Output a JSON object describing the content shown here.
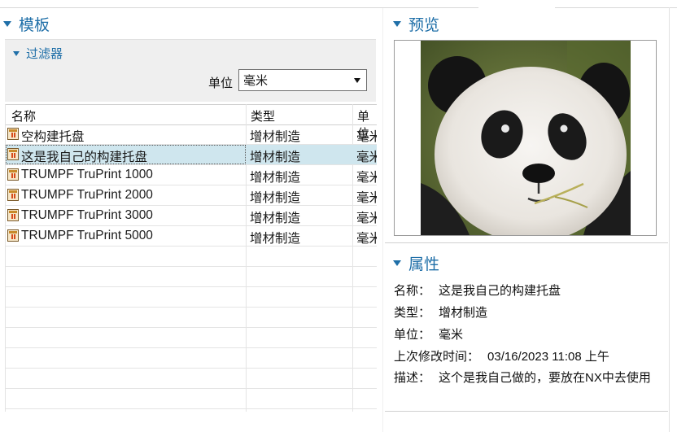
{
  "templates": {
    "title": "模板",
    "filter": {
      "title": "过滤器",
      "unit_label": "单位",
      "unit_value": "毫米"
    },
    "columns": [
      "名称",
      "类型",
      "单位"
    ],
    "rows": [
      {
        "name": "空构建托盘",
        "type": "增材制造",
        "unit": "毫米",
        "selected": false
      },
      {
        "name": "这是我自己的构建托盘",
        "type": "增材制造",
        "unit": "毫米",
        "selected": true
      },
      {
        "name": "TRUMPF TruPrint 1000",
        "type": "增材制造",
        "unit": "毫米",
        "selected": false
      },
      {
        "name": "TRUMPF TruPrint 2000",
        "type": "增材制造",
        "unit": "毫米",
        "selected": false
      },
      {
        "name": "TRUMPF TruPrint 3000",
        "type": "增材制造",
        "unit": "毫米",
        "selected": false
      },
      {
        "name": "TRUMPF TruPrint 5000",
        "type": "增材制造",
        "unit": "毫米",
        "selected": false
      }
    ]
  },
  "preview": {
    "title": "预览",
    "image_icon": "panda-photo"
  },
  "properties": {
    "title": "属性",
    "items": [
      {
        "key": "名称：",
        "value": "这是我自己的构建托盘"
      },
      {
        "key": "类型：",
        "value": "增材制造"
      },
      {
        "key": "单位：",
        "value": "毫米"
      },
      {
        "key": "上次修改时间：",
        "value": "03/16/2023 11:08 上午"
      },
      {
        "key": "描述：",
        "value": "这个是我自己做的，要放在NX中去使用"
      }
    ]
  },
  "colors": {
    "accent": "#1f6fa8",
    "selection": "#cfe6ee"
  }
}
